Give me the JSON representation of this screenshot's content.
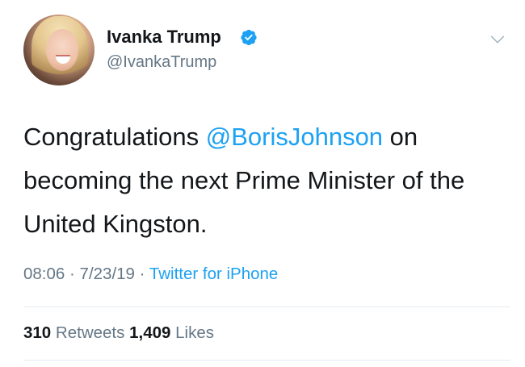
{
  "tweet": {
    "author_name": "Ivanka Trump",
    "handle": "@IvankaTrump",
    "text_before": "Congratulations ",
    "mention": "@BorisJohnson",
    "text_after": " on becoming the next Prime Minister of the United Kingston.",
    "time": "08:06",
    "date": "7/23/19",
    "separator": "·",
    "source": "Twitter for iPhone",
    "retweets_count": "310",
    "retweets_label": "Retweets",
    "likes_count": "1,409",
    "likes_label": "Likes"
  },
  "icons": {
    "verified": "verified-badge-icon",
    "menu": "chevron-down-icon"
  },
  "colors": {
    "accent": "#1da1f2",
    "text": "#14171a",
    "secondary": "#657786",
    "divider": "#e6ecf0"
  }
}
